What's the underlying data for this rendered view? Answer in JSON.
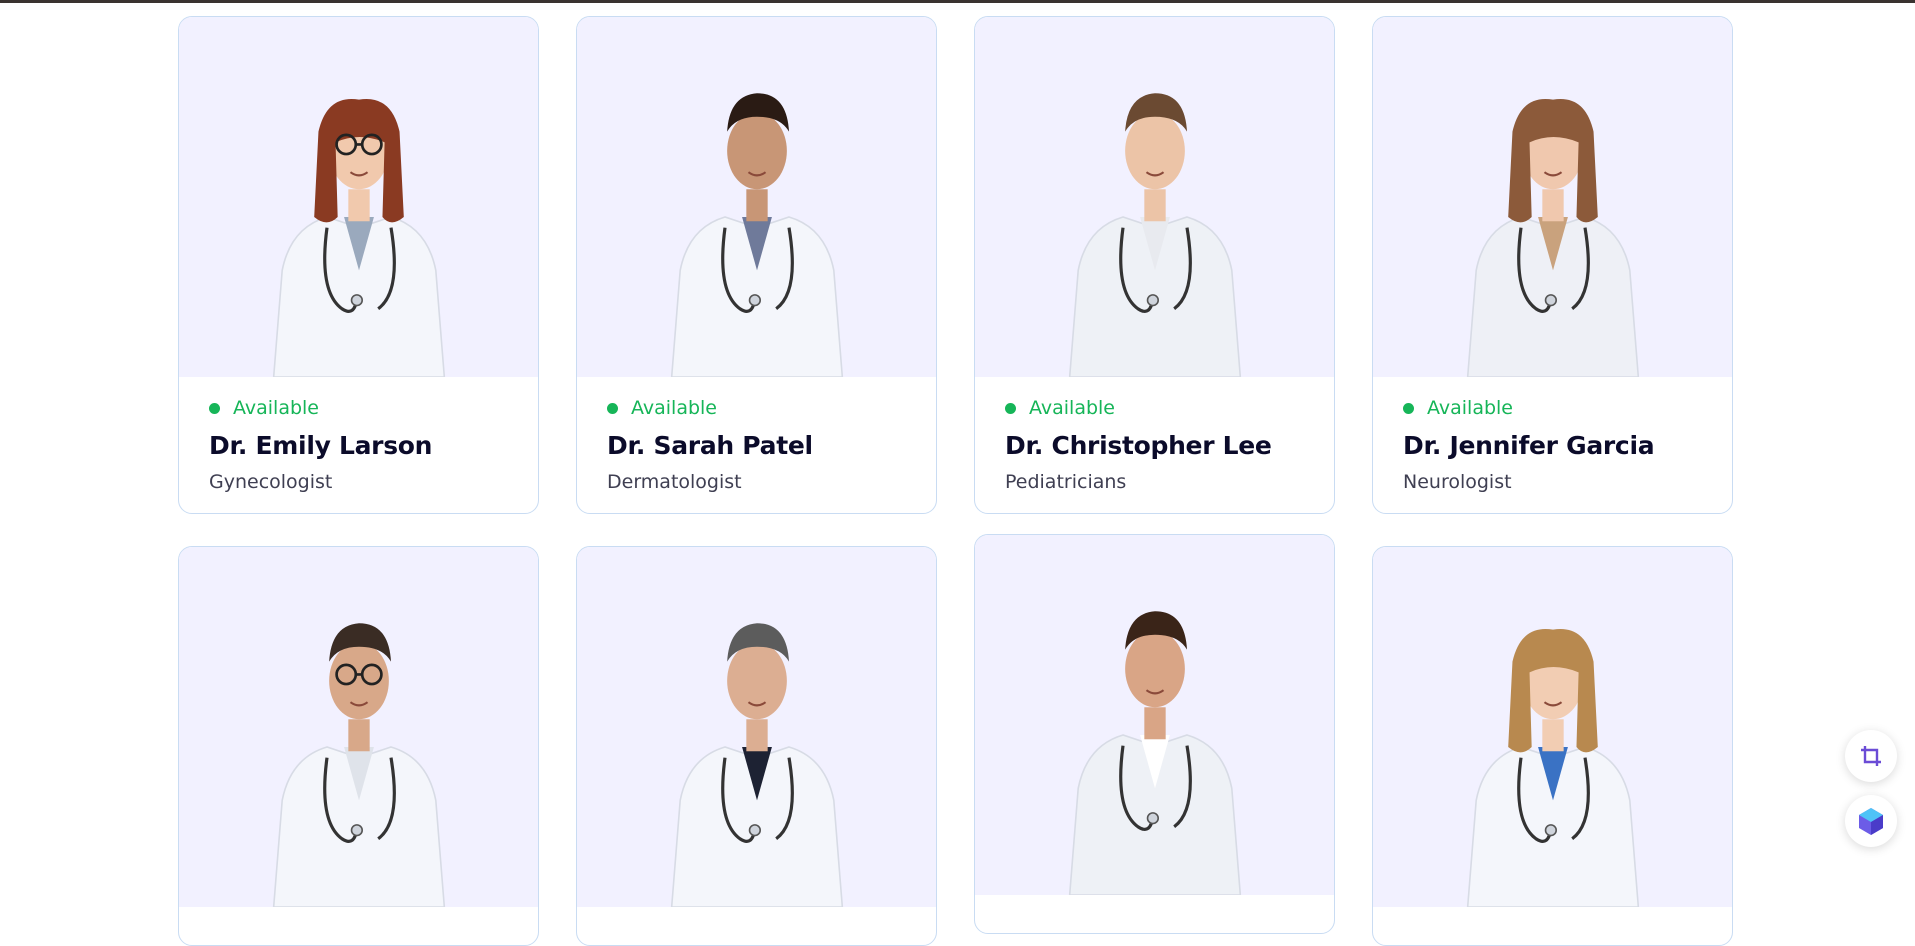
{
  "doctors": [
    {
      "status": "Available",
      "name": "Dr. Emily Larson",
      "specialty": "Gynecologist",
      "skin": "#f1c9ad",
      "hair": "#8a3a22",
      "coat": "#f4f6fb",
      "accent": "#9aa9bd",
      "glasses": true,
      "female": true
    },
    {
      "status": "Available",
      "name": "Dr. Sarah Patel",
      "specialty": "Dermatologist",
      "skin": "#c89676",
      "hair": "#2a1b14",
      "coat": "#f4f6fb",
      "accent": "#6f7a9a",
      "glasses": false,
      "female": false
    },
    {
      "status": "Available",
      "name": "Dr. Christopher Lee",
      "specialty": "Pediatricians",
      "skin": "#ecc4a7",
      "hair": "#6b4a32",
      "coat": "#eef1f6",
      "accent": "#e8eaef",
      "glasses": false,
      "female": false
    },
    {
      "status": "Available",
      "name": "Dr. Jennifer Garcia",
      "specialty": "Neurologist",
      "skin": "#f0c8ae",
      "hair": "#8c5a3a",
      "coat": "#eef0f6",
      "accent": "#c9a27d",
      "glasses": false,
      "female": true
    },
    {
      "status": "",
      "name": "",
      "specialty": "",
      "skin": "#d8a889",
      "hair": "#3a2c24",
      "coat": "#f4f6fb",
      "accent": "#dfe3ea",
      "glasses": true,
      "female": false
    },
    {
      "status": "",
      "name": "",
      "specialty": "",
      "skin": "#dcae92",
      "hair": "#5c5c5c",
      "coat": "#f4f6fb",
      "accent": "#1d2233",
      "glasses": false,
      "female": false
    },
    {
      "status": "",
      "name": "",
      "specialty": "",
      "skin": "#d9a586",
      "hair": "#3a2418",
      "coat": "#eef1f6",
      "accent": "#ffffff",
      "glasses": false,
      "female": false
    },
    {
      "status": "",
      "name": "",
      "specialty": "",
      "skin": "#f2cdb3",
      "hair": "#b8894f",
      "coat": "#f4f6fb",
      "accent": "#3a72c4",
      "glasses": false,
      "female": true
    }
  ],
  "colors": {
    "available_green": "#16b558",
    "card_border": "#c9dcf3",
    "photo_bg": "#f2f1ff"
  },
  "floating": {
    "crop_icon": "crop-icon",
    "app_icon": "cube-icon"
  }
}
